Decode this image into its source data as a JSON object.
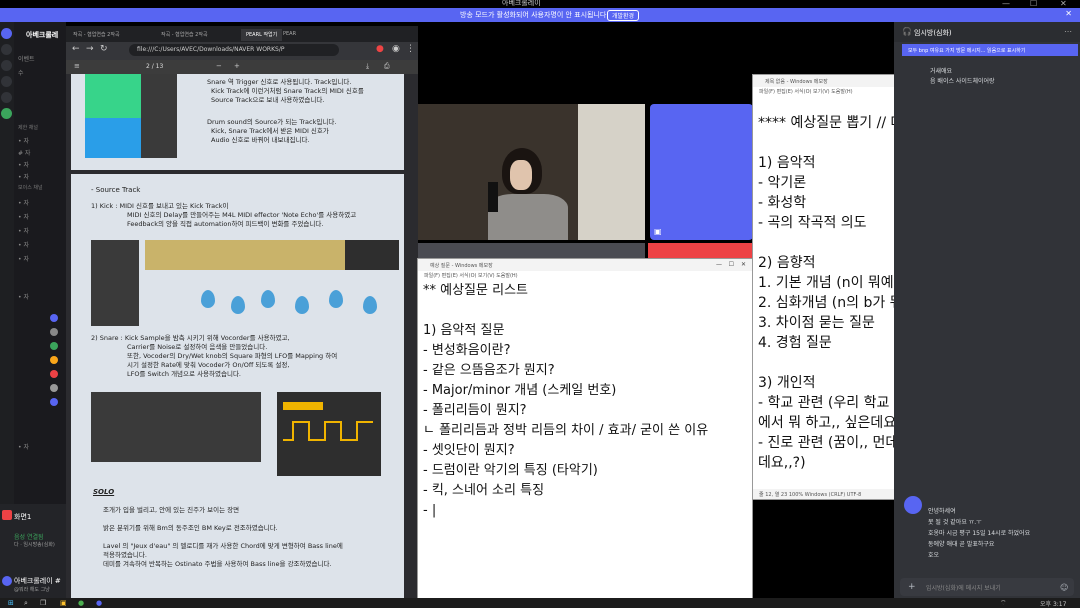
{
  "window": {
    "title": "아베크롤레이",
    "notice": "방송 모드가 활성화되어 사용자명이 안 표시됩니다.",
    "notice_button": "개발환경",
    "minimize": "—",
    "maximize": "☐",
    "close": "✕"
  },
  "discord_left": {
    "server_name": "아베크롤레",
    "channels": [
      "이벤트",
      "수",
      "제한 채널",
      "• 자",
      "# 자",
      "• 자",
      "• 자",
      "보이스 채널",
      "• 자",
      "• 자",
      "• 자",
      "• 자",
      "• 자",
      "• 자",
      "• 자"
    ],
    "voice_connected": "음성 연결됨",
    "voice_sub": "다 · 임시방송(심화)",
    "screen_label": "화면1",
    "user_name": "아베크롤레이 #",
    "user_status": "@뭐라 해도 그냥"
  },
  "pdf": {
    "tabs": [
      "작곡 - 협업연습 2작곡",
      "작곡 - 협업연습 2작곡",
      "PEARL 작업기",
      "PEAR"
    ],
    "url": "file:///C:/Users/AVEC/Downloads/NAVER WORKS/P",
    "page_indicator": "2 / 13",
    "page1_notes": [
      "Snare 역 Trigger 신호로 사용됩니다. Track입니다.",
      "Kick Track에 이런거처럼 Snare Track의 MIDI 신호를",
      "Source Track으로 보내 사용하였습니다.",
      "Drum sound의 Source가 되는 Track입니다.",
      "Kick, Snare Track에서 받은 MIDI 신호가",
      "Audio 신호로 바꿔어 내보내집니다."
    ],
    "source_track_heading": "Source Track",
    "kick_lines": [
      "1)  Kick : MIDI 신호를 보내고 있는 Kick Track이",
      "MIDI 신호의 Delay를 만들어주는 M4L MIDI effector 'Note Echo'를 사용하였고",
      "Feedback의 양을 직접 automation하여 피드백이 변화를 주었습니다."
    ],
    "snare_lines": [
      "2)  Snare : Kick Sample을 밤측 시키기 위해 Vocorder를 사용하였고,",
      "Carrier를 Noise로 설정하여 음색을 만들었습니다.",
      "또한, Vocoder의 Dry/Wet knob의 Square 파형의 LFO를 Mapping 하여",
      "시기 설정한 Rate에 맞춰 Vocoder가 On/Off 되도록 설정,",
      "LFO를 Switch 개념으로 사용하였습니다."
    ],
    "solo_heading": "SOLO",
    "solo_lines": [
      "조개가 입을 벌리고, 안에 있는 진주가 보이는 장면",
      "밝은 분위기를 위해 Bm의 동주조인 BM Key로 전조하였습니다.",
      "Lavel 의 \"Jeux d'eau\" 의 멜로디를 재가 사용한 Chord에 맞게 변형하여 Bass line에",
      "적용하였습니다.",
      "데미를 겨속하여 반복하는 Ostinato 주법을 사용하여 Bass line을 강조하였습니다."
    ]
  },
  "notepad1": {
    "title": "예상 질문 - Windows 메모장",
    "menu": "파일(F)  편집(E)  서식(O)  보기(V)  도움말(H)",
    "lines": [
      "** 예상질문 리스트",
      "",
      "1) 음악적 질문",
      "- 변성화음이란?",
      "- 같은 으뜸음조가 뭔지?",
      "- Major/minor 개념 (스케일 번호)",
      "- 폴리리듬이 뭔지?",
      "  ㄴ 폴리리듬과 정박 리듬의 차이 / 효과/ 굳이 쓴 이유",
      "- 셋잇단이 뭔지?",
      "- 드럼이란 악기의 특징 (타악기)",
      "- 킥, 스네어 소리 특징",
      "- |"
    ]
  },
  "notepad2": {
    "title": "제목 없음 - Windows 메모장",
    "menu": "파일(F)  편집(E)  서식(O)  보기(V)  도움말(H)",
    "lines": [
      "**** 예상질문 뽑기 // 대본 쓰기 ****",
      "",
      "1) 음악적",
      "- 악기론",
      "- 화성학",
      "- 곡의 작곡적 의도",
      "",
      "2) 음향적",
      "1. 기본 개념 (n이 뭐예요?)",
      "2. 심화개념 (n의 b가 뭐에요?)",
      "3. 차이점 묻는 질문",
      "4. 경험 질문",
      "",
      "3) 개인적",
      "- 학교 관련 (우리 학교 왜,, 올 건데요,,? // 우리 학교에서 뭐 하고,, 싶은데요,,?)",
      "- 진로 관련 (꿈이,, 먼데요,,? // 졸업하고 머하고 싶은데요,,?)"
    ],
    "status": "줄 12, 열 23     100%     Windows (CRLF)     UTF-8"
  },
  "chat": {
    "header": "임시방(심화)",
    "banner": "모두 bnp 여유요 가지 방문 메시지... 읽음으로 표시하기",
    "top_messages": [
      "거새애요",
      "음 배이스 사이드체이어랑"
    ],
    "messages": [
      "안녕하세여",
      "못 될 것 같아요 ㅠ.ㅜ",
      "호옹마 시금 평구 15일 14시로 하었어요",
      "동에양 애대 곧 발표하구요",
      "호오"
    ],
    "input_placeholder": "임시방(심화)에 메시지 보내기"
  },
  "taskbar": {
    "time": "오후 3:17"
  },
  "colors": {
    "discord_blurple": "#5865f2",
    "discord_red": "#ed4245",
    "lfo_yellow": "#f0b400"
  }
}
